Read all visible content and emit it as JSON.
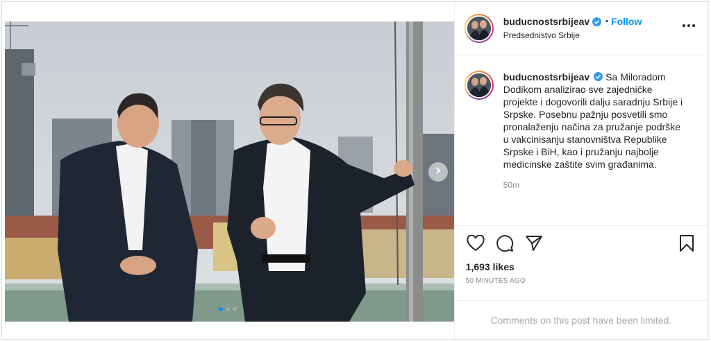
{
  "post": {
    "username": "buducnostsrbijeav",
    "verified": true,
    "separator": "•",
    "follow_label": "Follow",
    "location": "Predsednistvo Srbije",
    "more_icon": "more-options-icon",
    "caption": "Sa Miloradom Dodikom analizirao sve zajedničke projekte i dogovorili dalju saradnju Srbije i Srpske. Posebnu pažnju posvetili smo pronalaženju načina za pružanje podrške u vakcinisanju stanovništva Republike Srpske i BiH, kao i pružanju najbolje medicinske zaštite svim građanima.",
    "relative_time": "50m",
    "likes": "1,693 likes",
    "timestamp": "50 MINUTES AGO",
    "comments_notice": "Comments on this post have been limited.",
    "carousel": {
      "count": 3,
      "active_index": 0
    }
  },
  "icons": {
    "like": "heart-icon",
    "comment": "comment-icon",
    "share": "share-icon",
    "save": "bookmark-icon",
    "next": "chevron-right-icon",
    "verified": "verified-badge-icon"
  },
  "colors": {
    "accent": "#0095f6",
    "text": "#262626",
    "muted": "#8e8e8e",
    "border": "#dbdbdb"
  }
}
